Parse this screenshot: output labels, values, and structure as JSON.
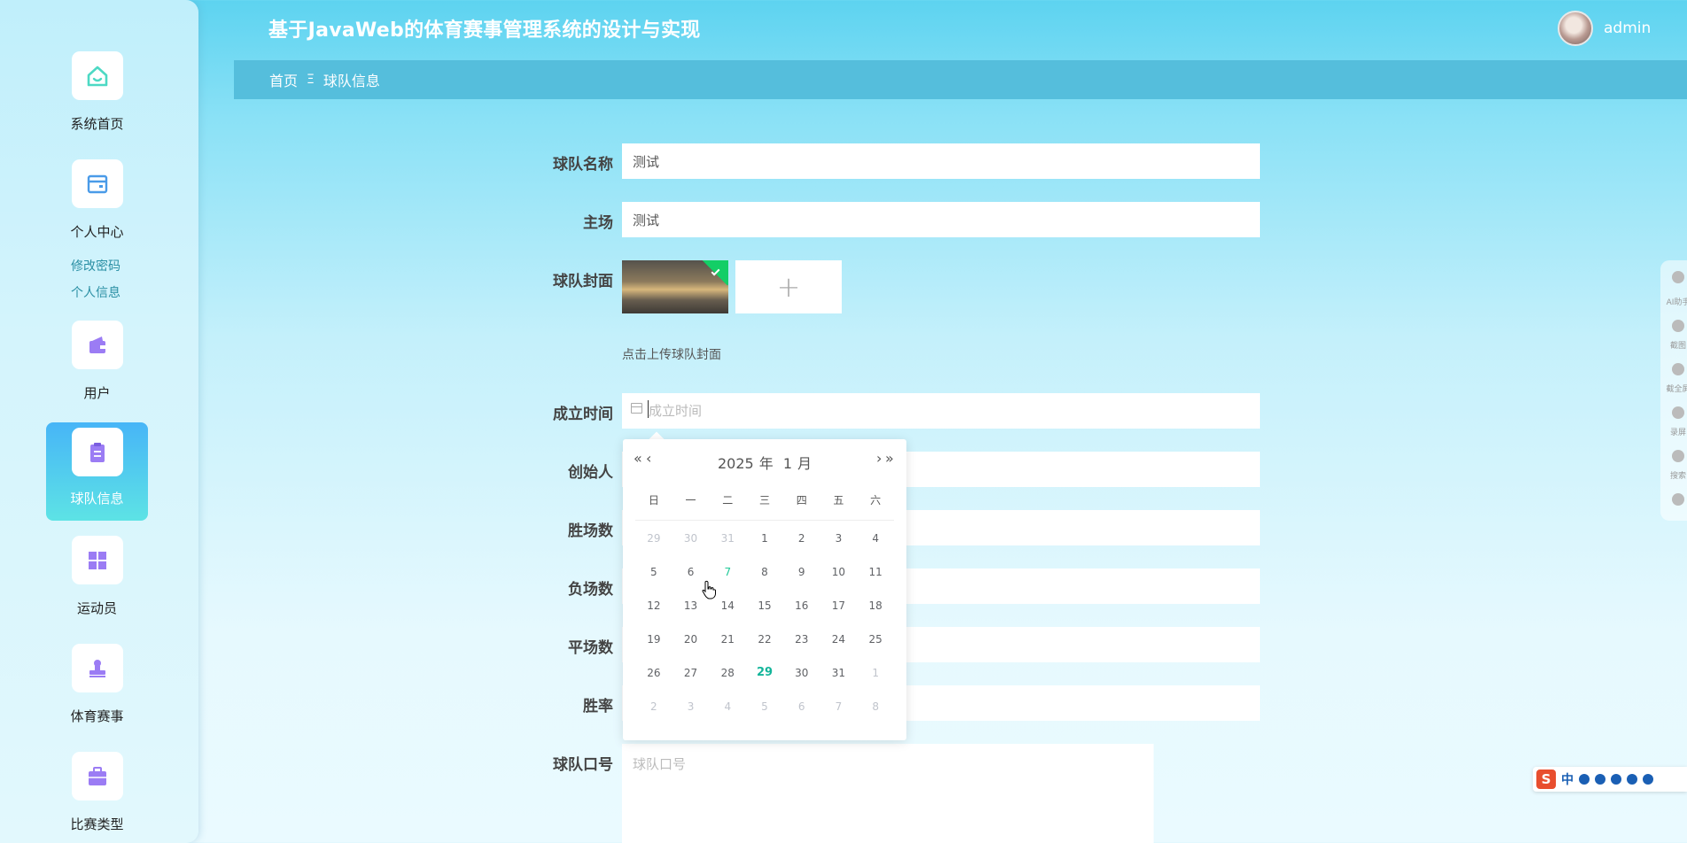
{
  "app": {
    "title": "基于JavaWeb的体育赛事管理系统的设计与实现",
    "username": "admin"
  },
  "sidebar": {
    "items": [
      {
        "label": "系统首页",
        "icon": "home-icon"
      },
      {
        "label": "个人中心",
        "icon": "card-icon"
      },
      {
        "label": "用户",
        "icon": "wallet-icon"
      },
      {
        "label": "球队信息",
        "icon": "clipboard-icon"
      },
      {
        "label": "运动员",
        "icon": "grid-icon"
      },
      {
        "label": "体育赛事",
        "icon": "stamp-icon"
      },
      {
        "label": "比赛类型",
        "icon": "briefcase-icon"
      }
    ],
    "sublinks": [
      "修改密码",
      "个人信息"
    ],
    "active_index": 3,
    "colors": {
      "icon_teal": "#4dd9c4",
      "icon_blue": "#4a9be8",
      "icon_purple": "#9b7cf4",
      "active_from": "#47b5f7",
      "active_to": "#5de3e5"
    }
  },
  "breadcrumb": {
    "home": "首页",
    "separator": "Ξ",
    "current": "球队信息"
  },
  "form": {
    "team_name": {
      "label": "球队名称",
      "value": "测试"
    },
    "home_field": {
      "label": "主场",
      "value": "测试"
    },
    "cover": {
      "label": "球队封面",
      "tip": "点击上传球队封面",
      "add_symbol": "+"
    },
    "founded": {
      "label": "成立时间",
      "placeholder": "成立时间"
    },
    "founder": {
      "label": "创始人"
    },
    "wins": {
      "label": "胜场数"
    },
    "losses": {
      "label": "负场数"
    },
    "draws": {
      "label": "平场数"
    },
    "win_rate": {
      "label": "胜率"
    },
    "slogan": {
      "label": "球队口号",
      "placeholder": "球队口号"
    }
  },
  "datepicker": {
    "prev_year": "«",
    "prev_month": "‹",
    "next_month": "›",
    "next_year": "»",
    "year": "2025",
    "year_unit": "年",
    "month": "1",
    "month_unit": "月",
    "weekdays": [
      "日",
      "一",
      "二",
      "三",
      "四",
      "五",
      "六"
    ],
    "days": [
      {
        "d": "29",
        "type": "other"
      },
      {
        "d": "30",
        "type": "other"
      },
      {
        "d": "31",
        "type": "other"
      },
      {
        "d": "1",
        "type": "cur"
      },
      {
        "d": "2",
        "type": "cur"
      },
      {
        "d": "3",
        "type": "cur"
      },
      {
        "d": "4",
        "type": "cur"
      },
      {
        "d": "5",
        "type": "cur"
      },
      {
        "d": "6",
        "type": "cur"
      },
      {
        "d": "7",
        "type": "today"
      },
      {
        "d": "8",
        "type": "cur"
      },
      {
        "d": "9",
        "type": "cur"
      },
      {
        "d": "10",
        "type": "cur"
      },
      {
        "d": "11",
        "type": "cur"
      },
      {
        "d": "12",
        "type": "cur"
      },
      {
        "d": "13",
        "type": "cur"
      },
      {
        "d": "14",
        "type": "cur"
      },
      {
        "d": "15",
        "type": "cur"
      },
      {
        "d": "16",
        "type": "cur"
      },
      {
        "d": "17",
        "type": "cur"
      },
      {
        "d": "18",
        "type": "cur"
      },
      {
        "d": "19",
        "type": "cur"
      },
      {
        "d": "20",
        "type": "cur"
      },
      {
        "d": "21",
        "type": "cur"
      },
      {
        "d": "22",
        "type": "cur"
      },
      {
        "d": "23",
        "type": "cur"
      },
      {
        "d": "24",
        "type": "cur"
      },
      {
        "d": "25",
        "type": "cur"
      },
      {
        "d": "26",
        "type": "cur"
      },
      {
        "d": "27",
        "type": "cur"
      },
      {
        "d": "28",
        "type": "cur"
      },
      {
        "d": "29",
        "type": "selected"
      },
      {
        "d": "30",
        "type": "cur"
      },
      {
        "d": "31",
        "type": "cur"
      },
      {
        "d": "1",
        "type": "other"
      },
      {
        "d": "2",
        "type": "other"
      },
      {
        "d": "3",
        "type": "other"
      },
      {
        "d": "4",
        "type": "other"
      },
      {
        "d": "5",
        "type": "other"
      },
      {
        "d": "6",
        "type": "other"
      },
      {
        "d": "7",
        "type": "other"
      },
      {
        "d": "8",
        "type": "other"
      }
    ]
  },
  "float_toolbar": {
    "labels": [
      "AI助手",
      "截图",
      "截全屏",
      "录屏",
      "搜索"
    ]
  },
  "ime": {
    "logo": "S",
    "mode": "中"
  }
}
